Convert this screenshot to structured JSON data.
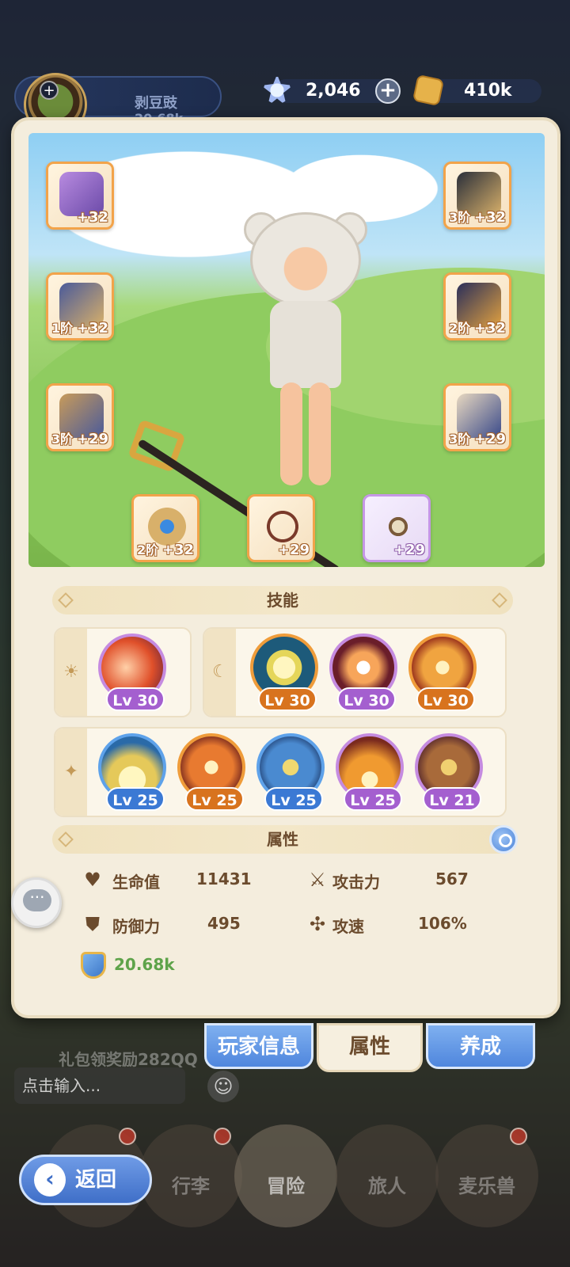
{
  "header": {
    "player_name": "剥豆豉",
    "player_power": "20.68k",
    "gems": "2,046",
    "gold": "410k"
  },
  "equipment": {
    "weapon": {
      "level": "+32",
      "tier": ""
    },
    "helmet": {
      "level": "+32",
      "tier": "3阶"
    },
    "armor": {
      "level": "+32",
      "tier": "1阶"
    },
    "gloves": {
      "level": "+32",
      "tier": "2阶"
    },
    "belt": {
      "level": "+29",
      "tier": "3阶"
    },
    "boots": {
      "level": "+29",
      "tier": "3阶"
    },
    "ring": {
      "level": "+32",
      "tier": "2阶"
    },
    "necklace": {
      "level": "+29",
      "tier": ""
    },
    "amulet": {
      "level": "+29",
      "tier": ""
    }
  },
  "skills": {
    "title": "技能",
    "row1_left": [
      {
        "level": "Lv 30",
        "color": "purple"
      }
    ],
    "row1_right": [
      {
        "level": "Lv 30",
        "color": "orange"
      },
      {
        "level": "Lv 30",
        "color": "purple"
      },
      {
        "level": "Lv 30",
        "color": "orange"
      }
    ],
    "row2": [
      {
        "level": "Lv 25",
        "color": "blue"
      },
      {
        "level": "Lv 25",
        "color": "orange"
      },
      {
        "level": "Lv 25",
        "color": "blue"
      },
      {
        "level": "Lv 25",
        "color": "purple"
      },
      {
        "level": "Lv 21",
        "color": "purple"
      }
    ]
  },
  "attributes": {
    "title": "属性",
    "hp_label": "生命值",
    "hp_value": "11431",
    "atk_label": "攻击力",
    "atk_value": "567",
    "def_label": "防御力",
    "def_value": "495",
    "spd_label": "攻速",
    "spd_value": "106%",
    "power": "20.68k"
  },
  "tabs": {
    "player_info": "玩家信息",
    "attributes": "属性",
    "cultivate": "养成"
  },
  "bottom": {
    "bg_text": "礼包领奖励282QQ",
    "input_placeholder": "点击输入...",
    "back": "返回",
    "nav": [
      "",
      "行李",
      "冒险",
      "旅人",
      "麦乐兽"
    ]
  },
  "colors": {
    "accent_blue": "#4f86dd",
    "panel_bg": "#f4eddd",
    "power_green": "#5ea34a"
  }
}
